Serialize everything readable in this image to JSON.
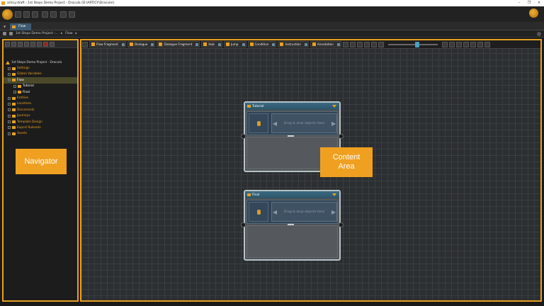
{
  "window": {
    "title": "articy:draft - 1st Steps Demo Project - Dracula (D:\\ARTICY\\Dracula\\)",
    "controls": [
      "–",
      "❐",
      "✕"
    ]
  },
  "tab": {
    "label": "Flow"
  },
  "breadcrumb": {
    "items": [
      "1st Steps Demo Project -...",
      "▸",
      "Flow",
      "▸"
    ]
  },
  "navigator": {
    "tree": [
      {
        "label": "1st Steps Demo Project - Dracula",
        "level": 0
      },
      {
        "label": "Settings",
        "level": 1
      },
      {
        "label": "Global Variables",
        "level": 1
      },
      {
        "label": "Flow",
        "level": 1
      },
      {
        "label": "Tutorial",
        "level": 2
      },
      {
        "label": "Final",
        "level": 2
      },
      {
        "label": "Entities",
        "level": 1
      },
      {
        "label": "Locations",
        "level": 1
      },
      {
        "label": "Documents",
        "level": 1
      },
      {
        "label": "Journeys",
        "level": 1
      },
      {
        "label": "Template Design",
        "level": 1
      },
      {
        "label": "Export Rulesets",
        "level": 1
      },
      {
        "label": "Assets",
        "level": 1
      }
    ]
  },
  "content_toolbar": {
    "items": [
      "Flow Fragment",
      "Dialogue",
      "Dialogue Fragment",
      "Hub",
      "Jump",
      "Condition",
      "Instruction",
      "Annotation"
    ]
  },
  "nodes": [
    {
      "title": "Tutorial",
      "drop_hint": "Drag & drop objects here"
    },
    {
      "title": "Final",
      "drop_hint": "Drag & drop objects here"
    }
  ],
  "callouts": {
    "navigator": "Navigator",
    "content_line1": "Content",
    "content_line2": "Area"
  },
  "colors": {
    "accent": "#e8a020",
    "node_header": "#2d5468",
    "grid": "#2c2f31"
  }
}
